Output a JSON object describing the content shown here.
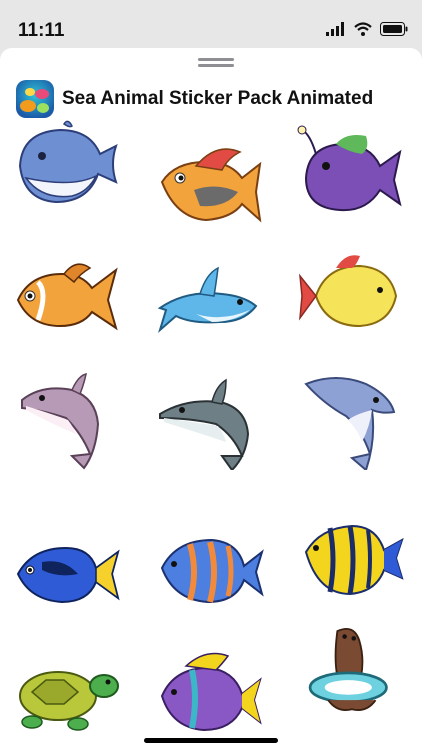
{
  "status_bar": {
    "time": "11:11",
    "icons": [
      "cellular-signal-icon",
      "wifi-icon",
      "battery-icon"
    ]
  },
  "header": {
    "title": "Sea Animal Sticker Pack Animated",
    "icon": "app-icon"
  },
  "stickers": [
    {
      "name": "whale-sticker"
    },
    {
      "name": "orange-fish-sticker"
    },
    {
      "name": "anglerfish-sticker"
    },
    {
      "name": "goldfish-sticker"
    },
    {
      "name": "shark-sticker"
    },
    {
      "name": "yellow-fish-sticker"
    },
    {
      "name": "pink-dolphin-sticker"
    },
    {
      "name": "grey-dolphin-sticker"
    },
    {
      "name": "blue-dolphin-sticker"
    },
    {
      "name": "blue-tang-sticker"
    },
    {
      "name": "striped-fish-sticker"
    },
    {
      "name": "angelfish-sticker"
    },
    {
      "name": "turtle-sticker"
    },
    {
      "name": "purple-fish-sticker"
    },
    {
      "name": "sea-lion-sticker"
    }
  ],
  "colors": {
    "status_bar_bg": "#e7e7e7",
    "sheet_bg": "#ffffff",
    "title_text": "#111111"
  }
}
